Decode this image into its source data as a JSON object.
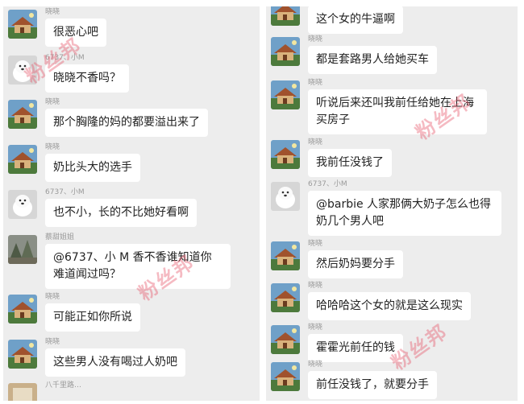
{
  "left_panel": {
    "messages": [
      {
        "sender": "晓晓",
        "text": "很恶心吧",
        "avatar": "house-avatar-icon"
      },
      {
        "sender": "6737、小M",
        "text": "晓晓不香吗？",
        "avatar": "dog-avatar-icon"
      },
      {
        "sender": "晓晓",
        "text": "那个胸隆的妈的都要溢出来了",
        "avatar": "house-avatar-icon"
      },
      {
        "sender": "晓晓",
        "text": "奶比头大的选手",
        "avatar": "house-avatar-icon"
      },
      {
        "sender": "6737、小M",
        "text": "也不小，长的不比她好看啊",
        "avatar": "dog-avatar-icon"
      },
      {
        "sender": "蔡甜姐姐",
        "text": "@6737、小 M  香不香谁知道你难道闻过吗？",
        "avatar": "forest-avatar-icon"
      },
      {
        "sender": "晓晓",
        "text": "可能正如你所说",
        "avatar": "house-avatar-icon"
      },
      {
        "sender": "晓晓",
        "text": "这些男人没有喝过人奶吧",
        "avatar": "house-avatar-icon"
      },
      {
        "sender": "八千里路…",
        "text": "",
        "avatar": "misc-avatar-icon"
      }
    ]
  },
  "right_panel": {
    "messages": [
      {
        "sender": "",
        "text": "这个女的牛逼啊",
        "avatar": "house-avatar-icon"
      },
      {
        "sender": "晓晓",
        "text": "都是套路男人给她买车",
        "avatar": "house-avatar-icon"
      },
      {
        "sender": "晓晓",
        "text": "听说后来还叫我前任给她在上海买房子",
        "avatar": "house-avatar-icon"
      },
      {
        "sender": "晓晓",
        "text": "我前任没钱了",
        "avatar": "house-avatar-icon"
      },
      {
        "sender": "6737、小M",
        "text": "@barbie 人家那俩大奶子怎么也得奶几个男人吧",
        "avatar": "dog-avatar-icon"
      },
      {
        "sender": "晓晓",
        "text": "然后奶妈要分手",
        "avatar": "house-avatar-icon"
      },
      {
        "sender": "晓晓",
        "text": "哈哈哈这个女的就是这么现实",
        "avatar": "house-avatar-icon"
      },
      {
        "sender": "晓晓",
        "text": "霍霍光前任的钱",
        "avatar": "house-avatar-icon"
      },
      {
        "sender": "晓晓",
        "text": "前任没钱了，就要分手",
        "avatar": "house-avatar-icon"
      }
    ]
  },
  "watermark": "粉丝邦",
  "colors": {
    "chat_background": "#ededed",
    "bubble": "#ffffff",
    "watermark": "#e85a6e"
  }
}
